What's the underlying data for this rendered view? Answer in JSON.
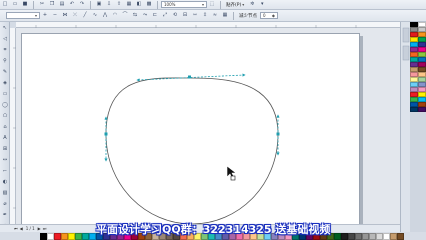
{
  "toolbar_top": {
    "zoom_value": "100%",
    "snap_label": "贴齐(P)"
  },
  "toolbar_prop": {
    "reduce_nodes_label": "减少节点",
    "spin_value": "0"
  },
  "pagebar": {
    "page_counter": "1 / 1"
  },
  "caption": {
    "text": "平面设计学习QQ群：322314325 送基础视频"
  },
  "colors": {
    "handle": "#1f9fb0",
    "curve": "#555555",
    "caption_outline": "#1a2fbf",
    "palette_right": [
      "#000000",
      "#ffffff",
      "#8a8a8a",
      "#c8c8c8",
      "#e21b1b",
      "#f7941d",
      "#ffe600",
      "#00a651",
      "#00aeef",
      "#2e3192",
      "#92278f",
      "#ec008c",
      "#f26522",
      "#8dc63f",
      "#00a99d",
      "#0072bc",
      "#662d91",
      "#9e005d",
      "#c69c6d",
      "#754c24",
      "#f5989d",
      "#fdc689",
      "#fff799",
      "#a3d39c",
      "#6dcff6",
      "#8393ca",
      "#bd8cbf",
      "#f49ac1",
      "#ed1c24",
      "#fff200",
      "#39b54a",
      "#00bff3",
      "#0054a6",
      "#a0410d",
      "#003663",
      "#440e62"
    ],
    "palette_bottom": [
      "#000000",
      "#ffffff",
      "#ed1c24",
      "#f7941d",
      "#fff200",
      "#39b54a",
      "#00a99d",
      "#00aeef",
      "#0054a6",
      "#2e3192",
      "#662d91",
      "#92278f",
      "#ec008c",
      "#9e0039",
      "#a0410d",
      "#8c6239",
      "#c7b299",
      "#998675",
      "#736357",
      "#534741",
      "#f26c4f",
      "#fbaf5d",
      "#fff568",
      "#7cc576",
      "#1cbbb4",
      "#448ccb",
      "#605ca8",
      "#a864a8",
      "#f06ea9",
      "#f5989d",
      "#fdc689",
      "#c4df9b",
      "#6ecff6",
      "#8781bd",
      "#bd8cbf",
      "#f49ac1",
      "#00746b",
      "#003471",
      "#630460",
      "#9e0b0f",
      "#603913",
      "#406618",
      "#005e20",
      "#1d1d1d",
      "#464646",
      "#707070",
      "#959595",
      "#b7b7b7",
      "#dcdcdc",
      "#ffffff",
      "#c69c6d",
      "#754c24"
    ]
  }
}
